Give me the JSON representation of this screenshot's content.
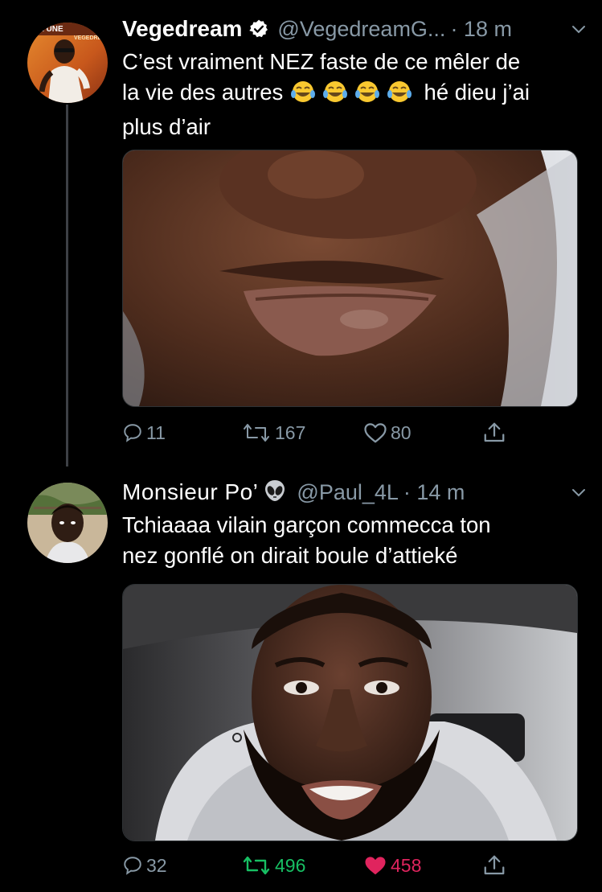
{
  "tweets": [
    {
      "name": "Vegedream",
      "handle": "@VegedreamG...",
      "time": "· 18 m",
      "text_line1": "C’est vraiment NEZ faste de ce mêler de",
      "text_line2_pre": "la vie des autres",
      "text_line2_post": "hé dieu j’ai",
      "text_line3": "plus d’air",
      "avatar_banner_text": "TE UNE",
      "avatar_banner_sub": "VEGEDRE",
      "replies": "11",
      "retweets": "167",
      "likes": "80"
    },
    {
      "name": "Monsieur Po’",
      "handle": "@Paul_4L",
      "time": "· 14 m",
      "text_line1": "Tchiaaaa vilain garçon commecca ton",
      "text_line2": "nez gonflé on dirait boule d’attieké",
      "replies": "32",
      "retweets": "496",
      "likes": "458"
    }
  ],
  "colors": {
    "background": "#000000",
    "secondary_text": "#8899a6",
    "retweeted_green": "#17bf63",
    "liked_pink": "#e0245e",
    "thread_line": "#3d4045"
  },
  "icons": {
    "reply": "reply-icon",
    "retweet": "retweet-icon",
    "like": "heart-icon",
    "share": "share-icon",
    "verified": "verified-badge-icon",
    "caret": "chevron-down-icon",
    "emoji_laugh": "tears-of-joy-emoji",
    "emoji_alien": "alien-emoji"
  }
}
